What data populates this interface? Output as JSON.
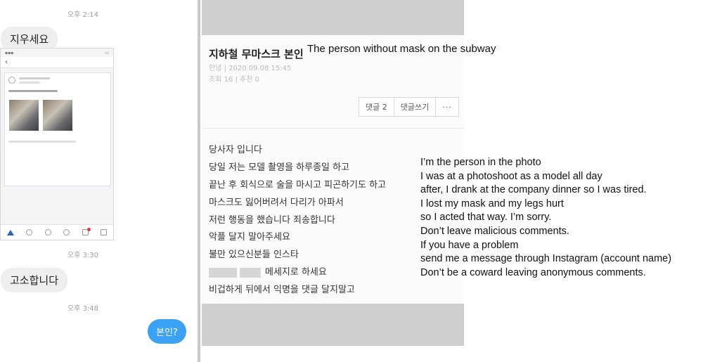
{
  "chat": {
    "time_1": "오후 2:14",
    "message_1": "지우세요",
    "time_2": "오후 3:30",
    "message_2": "고소합니다",
    "time_3": "오후 3:48",
    "message_3": "본인?"
  },
  "post": {
    "title": "지하철 무마스크 본인",
    "meta_author_date": "안녕 | 2020.09.08 15:45",
    "meta_views": "조회 16 | 추천 0",
    "buttons": {
      "comments": "댓글 2",
      "write_comment": "댓글쓰기",
      "more": "···"
    },
    "body_lines": [
      "당사자 입니다",
      "당일 저는 모델 촬영을 하루종일 하고",
      "끝난 후 회식으로 술을 마시고 피곤하기도 하고",
      "마스크도 잃어버려서 다리가 아파서",
      "저런 행동을 했습니다 죄송합니다",
      "악플 달지 말아주세요",
      "불만 있으신분들 인스타",
      "메세지로 하세요",
      "비겁하게 뒤에서 익명을 댓글 달지말고"
    ]
  },
  "annotations": {
    "caption": "The person without mask on the subway",
    "translation_lines": [
      "I’m the person in the photo",
      "I was at a photoshoot as a model all day",
      "after, I drank at the company dinner so I was tired.",
      "I lost my mask and my legs hurt",
      "so I acted that way. I’m sorry.",
      "Don’t leave malicious comments.",
      "If you have a problem",
      "send me a message through Instagram (account name)",
      "Don’t be a coward leaving anonymous comments."
    ]
  },
  "colors": {
    "outgoing_bubble": "#3ca2f4",
    "incoming_bubble": "#eeeeee",
    "gray_bar": "#cfcfcf"
  }
}
